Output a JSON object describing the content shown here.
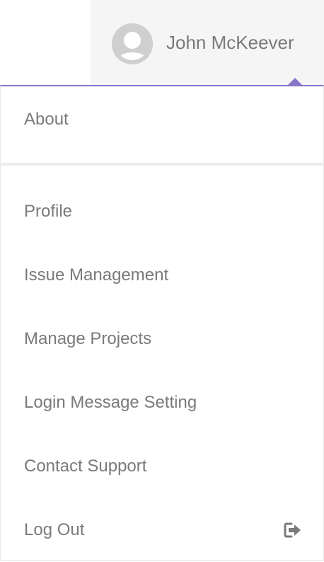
{
  "header": {
    "user_name": "John McKeever"
  },
  "menu": {
    "top_items": [
      {
        "label": "About"
      }
    ],
    "items": [
      {
        "label": "Profile"
      },
      {
        "label": "Issue Management"
      },
      {
        "label": "Manage Projects"
      },
      {
        "label": "Login Message Setting"
      },
      {
        "label": "Contact Support"
      },
      {
        "label": "Log Out",
        "icon": "logout-icon"
      }
    ]
  },
  "colors": {
    "accent": "#8a74c9",
    "text": "#7a7a7a",
    "header_bg": "#f5f5f5",
    "avatar": "#cfcfcf"
  }
}
